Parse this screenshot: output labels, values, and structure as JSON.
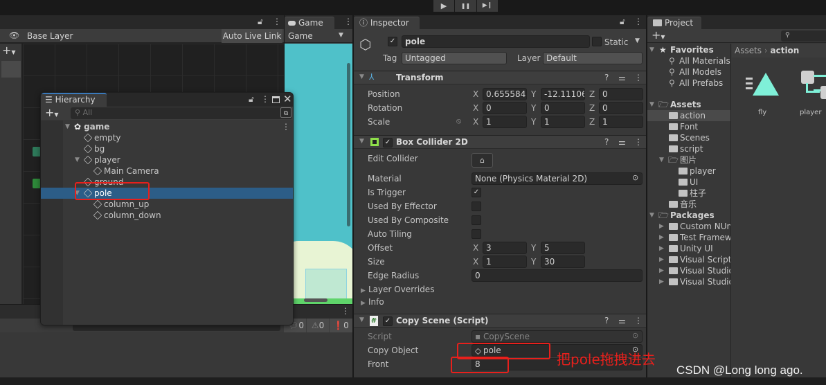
{
  "toolbar": {
    "play": "▶",
    "pause": "❚❚",
    "step": "▶❙"
  },
  "animator": {
    "layer": "Base Layer",
    "live_link": "Auto Live Link"
  },
  "game": {
    "tab": "Game",
    "display": "Game",
    "sky_color": "#4fc1c9"
  },
  "console": {
    "log_count": "0",
    "warn_count": "0",
    "error_count": "0"
  },
  "hierarchy": {
    "title": "Hierarchy",
    "search_placeholder": "All",
    "items": [
      {
        "label": "game",
        "depth": 0,
        "expanded": true,
        "scene": true
      },
      {
        "label": "empty",
        "depth": 1
      },
      {
        "label": "bg",
        "depth": 1
      },
      {
        "label": "player",
        "depth": 1,
        "expanded": true
      },
      {
        "label": "Main Camera",
        "depth": 2
      },
      {
        "label": "ground",
        "depth": 1
      },
      {
        "label": "pole",
        "depth": 1,
        "expanded": true,
        "selected": true
      },
      {
        "label": "column_up",
        "depth": 2
      },
      {
        "label": "column_down",
        "depth": 2
      }
    ]
  },
  "inspector": {
    "title": "Inspector",
    "name": "pole",
    "active": true,
    "static_label": "Static",
    "tag_label": "Tag",
    "tag": "Untagged",
    "layer_label": "Layer",
    "layer": "Default",
    "transform": {
      "title": "Transform",
      "rows": [
        {
          "label": "Position",
          "x": "0.6555846",
          "y": "-12.11106",
          "z": "0"
        },
        {
          "label": "Rotation",
          "x": "0",
          "y": "0",
          "z": "0"
        },
        {
          "label": "Scale",
          "x": "1",
          "y": "1",
          "z": "1"
        }
      ]
    },
    "box_collider": {
      "title": "Box Collider 2D",
      "edit_collider": "Edit Collider",
      "material_label": "Material",
      "material": "None (Physics Material 2D)",
      "checks": [
        {
          "label": "Is Trigger",
          "checked": true
        },
        {
          "label": "Used By Effector",
          "checked": false
        },
        {
          "label": "Used By Composite",
          "checked": false
        },
        {
          "label": "Auto Tiling",
          "checked": false
        }
      ],
      "offset_label": "Offset",
      "offset_x": "3",
      "offset_y": "5",
      "size_label": "Size",
      "size_x": "1",
      "size_y": "30",
      "edge_radius_label": "Edge Radius",
      "edge_radius": "0",
      "layer_overrides": "Layer Overrides",
      "info": "Info"
    },
    "copy_scene": {
      "title": "Copy Scene (Script)",
      "script_label": "Script",
      "script": "CopyScene",
      "copy_object_label": "Copy Object",
      "copy_object": "pole",
      "front_label": "Front",
      "front": "8"
    }
  },
  "project": {
    "title": "Project",
    "breadcrumb_root": "Assets",
    "breadcrumb_current": "action",
    "tree": [
      {
        "label": "Favorites",
        "type": "header",
        "icon": "star"
      },
      {
        "label": "All Materials",
        "type": "search"
      },
      {
        "label": "All Models",
        "type": "search"
      },
      {
        "label": "All Prefabs",
        "type": "search"
      },
      {
        "label": "",
        "type": "gap"
      },
      {
        "label": "Assets",
        "type": "header",
        "icon": "folder-open"
      },
      {
        "label": "action",
        "type": "folder",
        "depth": 1,
        "selected": true
      },
      {
        "label": "Font",
        "type": "folder",
        "depth": 1
      },
      {
        "label": "Scenes",
        "type": "folder",
        "depth": 1
      },
      {
        "label": "script",
        "type": "folder",
        "depth": 1
      },
      {
        "label": "图片",
        "type": "folder-open",
        "depth": 1,
        "expanded": true
      },
      {
        "label": "player",
        "type": "folder",
        "depth": 2
      },
      {
        "label": "UI",
        "type": "folder",
        "depth": 2
      },
      {
        "label": "柱子",
        "type": "folder",
        "depth": 2
      },
      {
        "label": "音乐",
        "type": "folder",
        "depth": 1
      },
      {
        "label": "Packages",
        "type": "header",
        "icon": "folder-open"
      },
      {
        "label": "Custom NUnit",
        "type": "folder",
        "depth": 1,
        "collapsed": true
      },
      {
        "label": "Test Framework",
        "type": "folder",
        "depth": 1,
        "collapsed": true
      },
      {
        "label": "Unity UI",
        "type": "folder",
        "depth": 1,
        "collapsed": true
      },
      {
        "label": "Visual Scripting",
        "type": "folder",
        "depth": 1,
        "collapsed": true
      },
      {
        "label": "Visual Studio",
        "type": "folder",
        "depth": 1,
        "collapsed": true
      },
      {
        "label": "Visual Studio",
        "type": "folder",
        "depth": 1,
        "collapsed": true
      }
    ],
    "assets": [
      {
        "label": "fly",
        "icon": "animation-clip"
      },
      {
        "label": "player",
        "icon": "animator-controller"
      }
    ],
    "accent": "#7ff0d8"
  },
  "annotation": {
    "text": "把pole拖拽进去",
    "color": "#e8201c"
  },
  "watermark": "CSDN @Long long ago."
}
